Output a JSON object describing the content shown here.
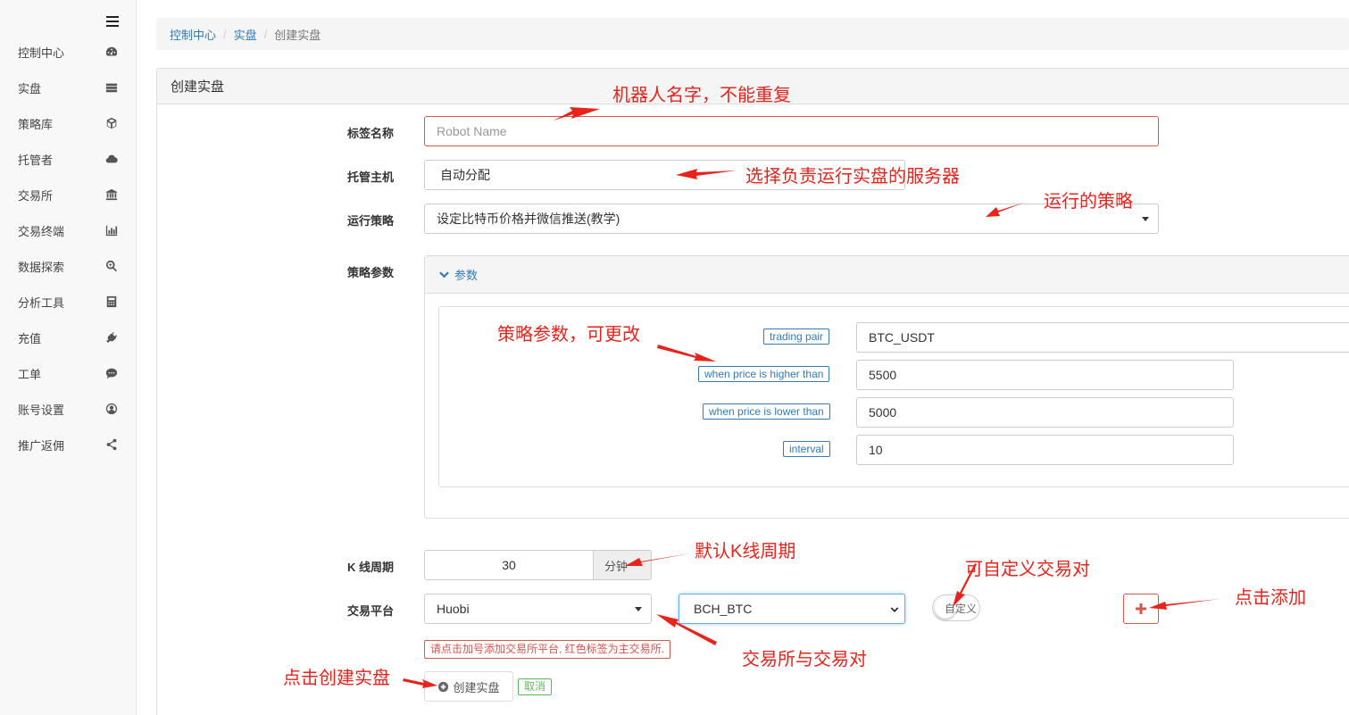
{
  "sidebar": {
    "items": [
      {
        "label": "控制中心",
        "icon": "dashboard-icon"
      },
      {
        "label": "实盘",
        "icon": "server-icon"
      },
      {
        "label": "策略库",
        "icon": "cube-icon"
      },
      {
        "label": "托管者",
        "icon": "cloud-icon"
      },
      {
        "label": "交易所",
        "icon": "bank-icon"
      },
      {
        "label": "交易终端",
        "icon": "bar-chart-icon"
      },
      {
        "label": "数据探索",
        "icon": "search-plus-icon"
      },
      {
        "label": "分析工具",
        "icon": "calculator-icon"
      },
      {
        "label": "充值",
        "icon": "plug-icon"
      },
      {
        "label": "工单",
        "icon": "comment-icon"
      },
      {
        "label": "账号设置",
        "icon": "user-circle-icon"
      },
      {
        "label": "推广返佣",
        "icon": "share-icon"
      }
    ]
  },
  "breadcrumb": {
    "home": "控制中心",
    "parent": "实盘",
    "current": "创建实盘"
  },
  "panel": {
    "title": "创建实盘"
  },
  "form": {
    "name_label": "标签名称",
    "name_placeholder": "Robot Name",
    "host_label": "托管主机",
    "host_value": "自动分配",
    "strategy_label": "运行策略",
    "strategy_value": "设定比特币价格并微信推送(教学)",
    "params_label": "策略参数",
    "params_toggle": "参数",
    "params": [
      {
        "name": "trading pair",
        "value": "BTC_USDT"
      },
      {
        "name": "when price is higher than",
        "value": "5500"
      },
      {
        "name": "when price is lower than",
        "value": "5000"
      },
      {
        "name": "interval",
        "value": "10"
      }
    ],
    "kline_label": "K 线周期",
    "kline_value": "30",
    "kline_unit": "分钟",
    "exchange_label": "交易平台",
    "exchange_value": "Huobi",
    "pair_value": "BCH_BTC",
    "custom_label": "自定义",
    "warning": "请点击加号添加交易所平台, 红色标签为主交易所.",
    "create_label": "创建实盘",
    "cancel_label": "取消"
  },
  "annotations": {
    "robot_name": "机器人名字，不能重复",
    "host": "选择负责运行实盘的服务器",
    "strategy": "运行的策略",
    "params": "策略参数，可更改",
    "kline": "默认K线周期",
    "custom_pair": "可自定义交易对",
    "add": "点击添加",
    "exchange": "交易所与交易对",
    "create": "点击创建实盘"
  },
  "colors": {
    "accent": "#337ab7",
    "danger": "#d9534f",
    "success": "#5cb85c",
    "annotation": "#e8231b"
  }
}
